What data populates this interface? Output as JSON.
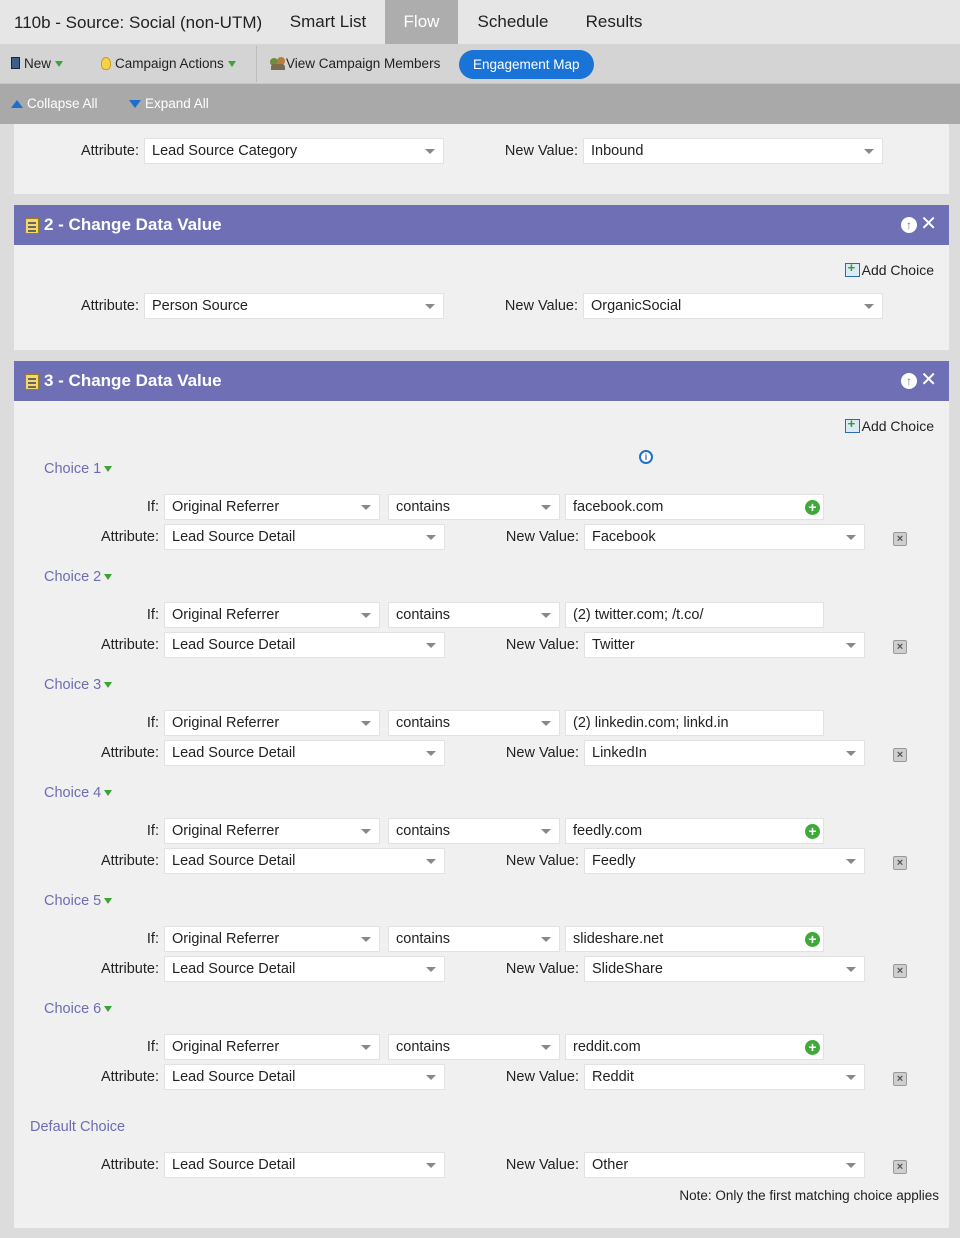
{
  "header": {
    "title": "110b - Source: Social (non-UTM)",
    "tabs": [
      "Smart List",
      "Flow",
      "Schedule",
      "Results"
    ],
    "active_tab": "Flow"
  },
  "toolbar": {
    "new_label": "New",
    "campaign_actions_label": "Campaign Actions",
    "view_members_label": "View Campaign Members",
    "engagement_map_label": "Engagement Map"
  },
  "collapse_bar": {
    "collapse_label": "Collapse All",
    "expand_label": "Expand All"
  },
  "step1": {
    "attribute_label": "Attribute:",
    "attribute_value": "Lead Source Category",
    "new_value_label": "New Value:",
    "new_value": "Inbound"
  },
  "step2": {
    "title": "2 - Change Data Value",
    "add_choice_label": "Add Choice",
    "attribute_label": "Attribute:",
    "attribute_value": "Person Source",
    "new_value_label": "New Value:",
    "new_value": "OrganicSocial"
  },
  "step3": {
    "title": "3 - Change Data Value",
    "add_choice_label": "Add Choice",
    "if_label": "If:",
    "attribute_label": "Attribute:",
    "new_value_label": "New Value:",
    "choices": [
      {
        "label": "Choice 1",
        "field": "Original Referrer",
        "operator": "contains",
        "match": "facebook.com",
        "attribute": "Lead Source Detail",
        "value": "Facebook"
      },
      {
        "label": "Choice 2",
        "field": "Original Referrer",
        "operator": "contains",
        "match": "(2) twitter.com; /t.co/",
        "attribute": "Lead Source Detail",
        "value": "Twitter"
      },
      {
        "label": "Choice 3",
        "field": "Original Referrer",
        "operator": "contains",
        "match": "(2) linkedin.com; linkd.in",
        "attribute": "Lead Source Detail",
        "value": "LinkedIn"
      },
      {
        "label": "Choice 4",
        "field": "Original Referrer",
        "operator": "contains",
        "match": "feedly.com",
        "attribute": "Lead Source Detail",
        "value": "Feedly"
      },
      {
        "label": "Choice 5",
        "field": "Original Referrer",
        "operator": "contains",
        "match": "slideshare.net",
        "attribute": "Lead Source Detail",
        "value": "SlideShare"
      },
      {
        "label": "Choice 6",
        "field": "Original Referrer",
        "operator": "contains",
        "match": "reddit.com",
        "attribute": "Lead Source Detail",
        "value": "Reddit"
      }
    ],
    "default_choice": {
      "label": "Default Choice",
      "attribute": "Lead Source Detail",
      "value": "Other"
    },
    "note": "Note: Only the first matching choice applies"
  }
}
